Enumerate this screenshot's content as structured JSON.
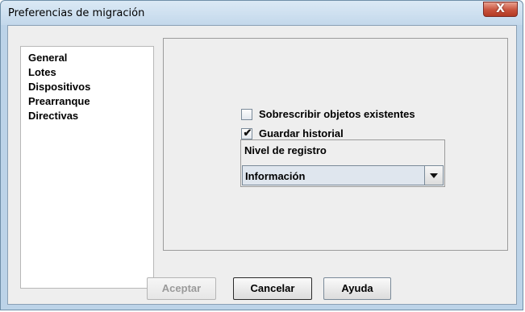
{
  "window": {
    "title": "Preferencias de migración",
    "close_label": "X"
  },
  "sidebar": {
    "items": [
      {
        "label": "General"
      },
      {
        "label": "Lotes"
      },
      {
        "label": "Dispositivos"
      },
      {
        "label": "Prearranque"
      },
      {
        "label": "Directivas"
      }
    ]
  },
  "options": {
    "overwrite": {
      "label": "Sobrescribir objetos existentes",
      "checked": false
    },
    "history": {
      "label": "Guardar historial",
      "checked": true,
      "check_mark": "✔"
    }
  },
  "log_level": {
    "label": "Nivel de registro",
    "value": "Información"
  },
  "buttons": {
    "accept": "Aceptar",
    "cancel": "Cancelar",
    "help": "Ayuda"
  }
}
